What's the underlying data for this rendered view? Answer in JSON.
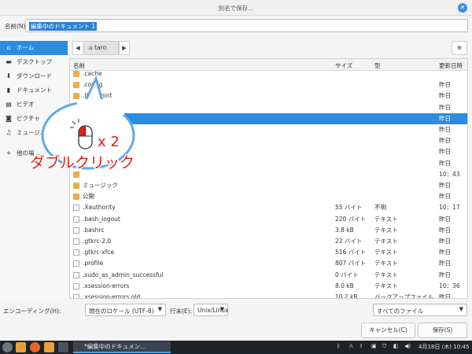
{
  "window": {
    "title": "別名で保存..."
  },
  "name_field": {
    "label": "名前(N):",
    "value": "編集中のドキュメント 1"
  },
  "sidebar": {
    "items": [
      {
        "label": "ホーム",
        "icon": "home-icon",
        "active": true
      },
      {
        "label": "デスクトップ",
        "icon": "desktop-icon"
      },
      {
        "label": "ダウンロード",
        "icon": "download-icon"
      },
      {
        "label": "ドキュメント",
        "icon": "document-icon"
      },
      {
        "label": "ビデオ",
        "icon": "video-icon"
      },
      {
        "label": "ピクチャ",
        "icon": "picture-icon"
      },
      {
        "label": "ミュージ…",
        "icon": "music-icon"
      },
      {
        "label": "他の場…",
        "icon": "plus-icon"
      }
    ]
  },
  "path_bar": {
    "crumb": "taro"
  },
  "columns": {
    "name": "名前",
    "size": "サイズ",
    "type": "型",
    "date": "更新日時"
  },
  "files": [
    {
      "name": ".cache",
      "size": "",
      "type": "",
      "date": "",
      "kind": "folder"
    },
    {
      "name": ".config",
      "size": "",
      "type": "",
      "date": "昨日",
      "kind": "folder"
    },
    {
      "name": ".linuxmint",
      "size": "",
      "type": "",
      "date": "昨日",
      "kind": "folder"
    },
    {
      "name": "",
      "size": "",
      "type": "",
      "date": "昨日",
      "kind": "folder"
    },
    {
      "name": "",
      "size": "",
      "type": "",
      "date": "昨日",
      "kind": "folder",
      "selected": true
    },
    {
      "name": "",
      "size": "",
      "type": "",
      "date": "昨日",
      "kind": "folder"
    },
    {
      "name": "",
      "size": "",
      "type": "",
      "date": "昨日",
      "kind": "folder"
    },
    {
      "name": "",
      "size": "",
      "type": "",
      "date": "昨日",
      "kind": "folder"
    },
    {
      "name": "",
      "size": "",
      "type": "",
      "date": "昨日",
      "kind": "folder"
    },
    {
      "name": "",
      "size": "",
      "type": "",
      "date": "10：43",
      "kind": "folder"
    },
    {
      "name": "ミュージック",
      "size": "",
      "type": "",
      "date": "昨日",
      "kind": "folder"
    },
    {
      "name": "公開",
      "size": "",
      "type": "",
      "date": "昨日",
      "kind": "folder"
    },
    {
      "name": ".Xauthority",
      "size": "55 バイト",
      "type": "不明",
      "date": "10：17",
      "kind": "file"
    },
    {
      "name": ".bash_logout",
      "size": "220 バイト",
      "type": "テキスト",
      "date": "昨日",
      "kind": "file"
    },
    {
      "name": ".bashrc",
      "size": "3.8 kB",
      "type": "テキスト",
      "date": "昨日",
      "kind": "file"
    },
    {
      "name": ".gtkrc-2.0",
      "size": "22 バイト",
      "type": "テキスト",
      "date": "昨日",
      "kind": "file"
    },
    {
      "name": ".gtkrc-xfce",
      "size": "516 バイト",
      "type": "テキスト",
      "date": "昨日",
      "kind": "file"
    },
    {
      "name": ".profile",
      "size": "807 バイト",
      "type": "テキスト",
      "date": "昨日",
      "kind": "file"
    },
    {
      "name": ".sudo_as_admin_successful",
      "size": "0 バイト",
      "type": "テキスト",
      "date": "昨日",
      "kind": "file"
    },
    {
      "name": ".xsession-errors",
      "size": "8.0 kB",
      "type": "テキスト",
      "date": "10：36",
      "kind": "file"
    },
    {
      "name": ".xsession-errors.old",
      "size": "10.2 kB",
      "type": "バックアップファイル",
      "date": "昨日",
      "kind": "file"
    }
  ],
  "annotation": {
    "count": "x 2",
    "caption": "ダブルクリック"
  },
  "bottom": {
    "encoding_label": "エンコーディング(H):",
    "encoding_value": "現在のロケール (UTF-8)",
    "lineend_label": "行末(E):",
    "lineend_value": "Unix/Linux",
    "filter_value": "すべてのファイル"
  },
  "buttons": {
    "cancel": "キャンセル(C)",
    "save": "保存(S)"
  },
  "taskbar": {
    "window_title": "*編集中のドキュメン…",
    "date_time": "4月18日 (木) 10:45",
    "input_mode": "A"
  },
  "colors": {
    "accent": "#2b8ce0",
    "annotation_red": "#e0201b"
  }
}
